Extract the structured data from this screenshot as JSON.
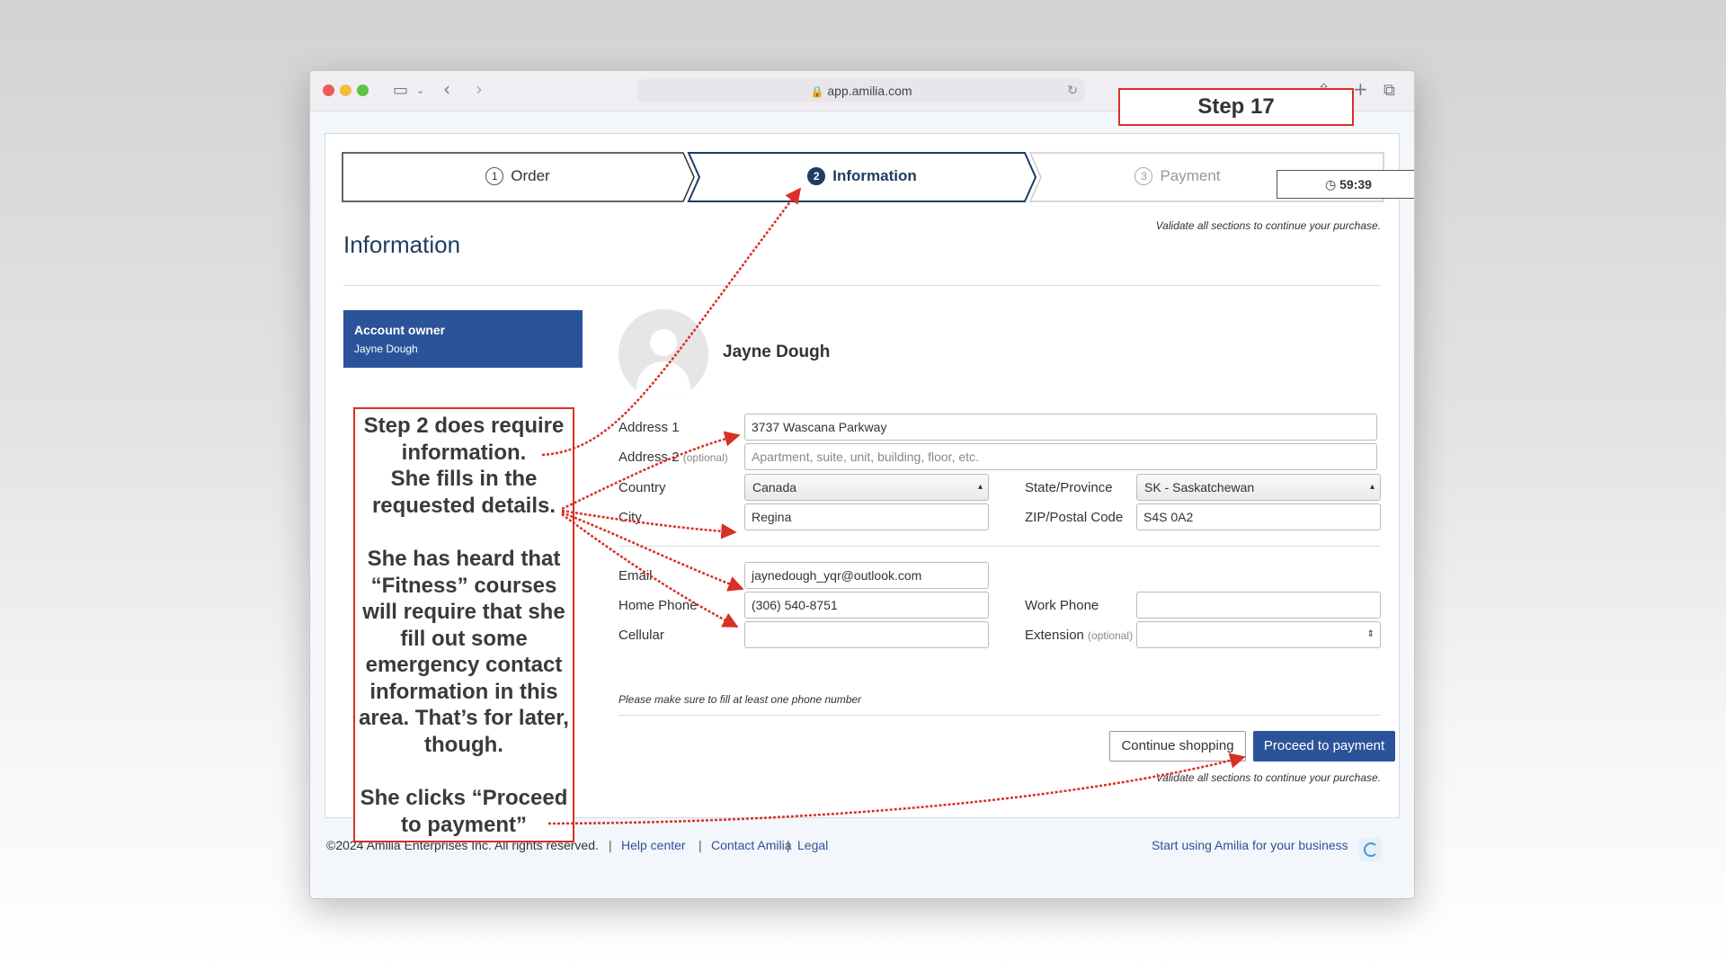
{
  "browser": {
    "url": "app.amilia.com"
  },
  "steps": [
    {
      "num": "1",
      "label": "Order"
    },
    {
      "num": "2",
      "label": "Information"
    },
    {
      "num": "3",
      "label": "Payment"
    }
  ],
  "timer": "59:39",
  "validate_hint": "Validate all sections to continue your purchase.",
  "page_title": "Information",
  "account": {
    "title": "Account owner",
    "name": "Jayne Dough"
  },
  "profile_name": "Jayne Dough",
  "form": {
    "address1": {
      "label": "Address 1",
      "value": "3737 Wascana Parkway"
    },
    "address2": {
      "label": "Address 2",
      "optional": "(optional)",
      "placeholder": "Apartment, suite, unit, building, floor, etc."
    },
    "country": {
      "label": "Country",
      "value": "Canada"
    },
    "state": {
      "label": "State/Province",
      "value": "SK - Saskatchewan"
    },
    "city": {
      "label": "City",
      "value": "Regina"
    },
    "zip": {
      "label": "ZIP/Postal Code",
      "value": "S4S 0A2"
    },
    "email": {
      "label": "Email",
      "value": "jaynedough_yqr@outlook.com"
    },
    "home_phone": {
      "label": "Home Phone",
      "value": "(306) 540-8751"
    },
    "work_phone": {
      "label": "Work Phone",
      "value": ""
    },
    "cellular": {
      "label": "Cellular",
      "value": ""
    },
    "extension": {
      "label": "Extension",
      "optional": "(optional)",
      "value": ""
    },
    "phone_note": "Please make sure to fill at least one phone number"
  },
  "buttons": {
    "continue": "Continue shopping",
    "proceed": "Proceed to payment"
  },
  "footer": {
    "copyright": "©2024 Amilia Enterprises Inc. All rights reserved.",
    "help": "Help center",
    "contact": "Contact Amilia",
    "legal": "Legal",
    "start": "Start using Amilia for your business",
    "sep": "|"
  },
  "annotation": {
    "step_label": "Step 17",
    "lines_a": [
      "Step 2 does require",
      "information.",
      "She fills in the",
      "requested details."
    ],
    "lines_b": [
      "She has heard that",
      "“Fitness” courses",
      "will require that she",
      "fill out some",
      "emergency contact",
      "information in this",
      "area. That’s for later,",
      "though."
    ],
    "lines_c": [
      "She clicks “Proceed",
      "to payment”"
    ],
    "color": "#d93025"
  },
  "colors": {
    "primary": "#2b539a",
    "heading": "#1f3c63"
  }
}
